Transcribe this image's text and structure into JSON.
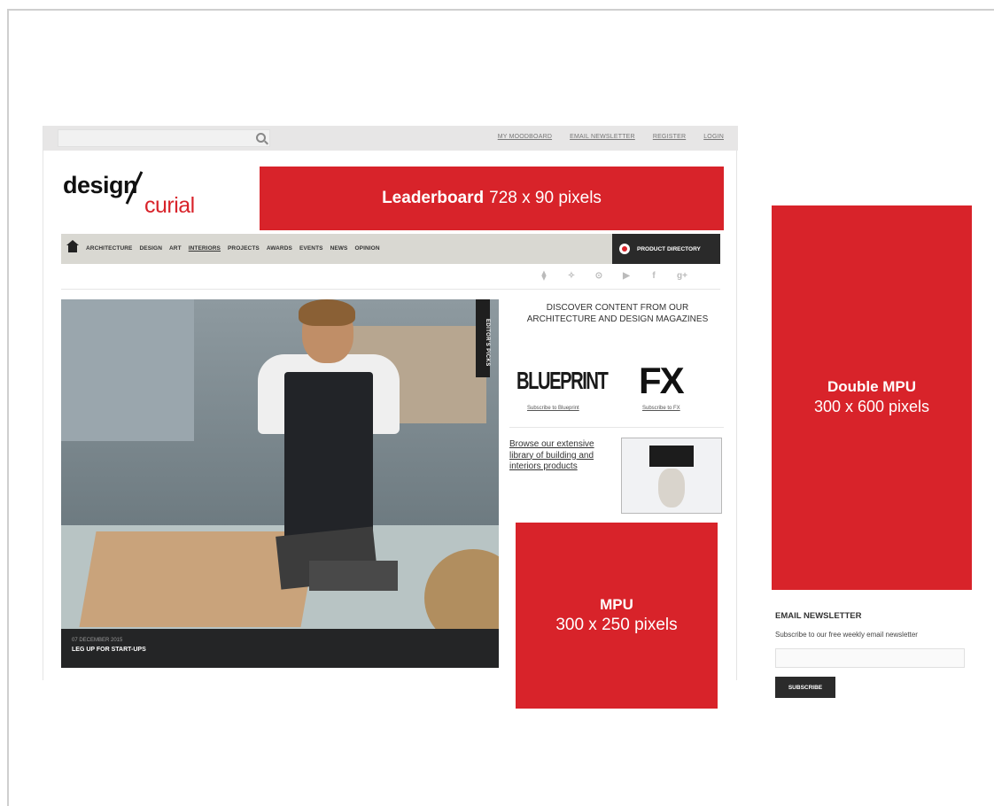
{
  "topbar": {
    "search_placeholder": "",
    "links": [
      "MY MOODBOARD",
      "EMAIL NEWSLETTER",
      "REGISTER",
      "LOGIN"
    ]
  },
  "logo": {
    "part1": "design",
    "part2": "curial"
  },
  "leaderboard": {
    "title": "Leaderboard",
    "size": "728 x 90 pixels"
  },
  "nav": {
    "items": [
      "ARCHITECTURE",
      "DESIGN",
      "ART",
      "INTERIORS",
      "PROJECTS",
      "AWARDS",
      "EVENTS",
      "NEWS",
      "OPINION"
    ],
    "active": "INTERIORS",
    "product_directory": "PRODUCT DIRECTORY"
  },
  "social_icons": [
    "rss-icon",
    "twitter-icon",
    "pinterest-icon",
    "youtube-icon",
    "facebook-icon",
    "google-plus-icon"
  ],
  "hero": {
    "badge": "EDITOR'S PICKS",
    "date": "07 DECEMBER 2015",
    "title": "LEG UP FOR START-UPS"
  },
  "discover": {
    "heading": "DISCOVER CONTENT FROM OUR ARCHITECTURE AND DESIGN MAGAZINES",
    "blueprint": "BLUEPRINT",
    "blueprint_link": "Subscribe to Blueprint",
    "fx": "FX",
    "fx_link": "Subscribe to FX"
  },
  "browse": {
    "text": "Browse our extensive library of building and interiors products"
  },
  "mpu": {
    "title": "MPU",
    "size": "300 x 250 pixels"
  },
  "double_mpu": {
    "title": "Double MPU",
    "size": "300 x 600 pixels"
  },
  "newsletter": {
    "title": "EMAIL NEWSLETTER",
    "text": "Subscribe to our free weekly email newsletter",
    "input_placeholder": "",
    "button": "SUBSCRIBE"
  },
  "colors": {
    "ad_red": "#d8232a",
    "dark": "#2a2a2a",
    "nav_bg": "#d9d8d2"
  }
}
